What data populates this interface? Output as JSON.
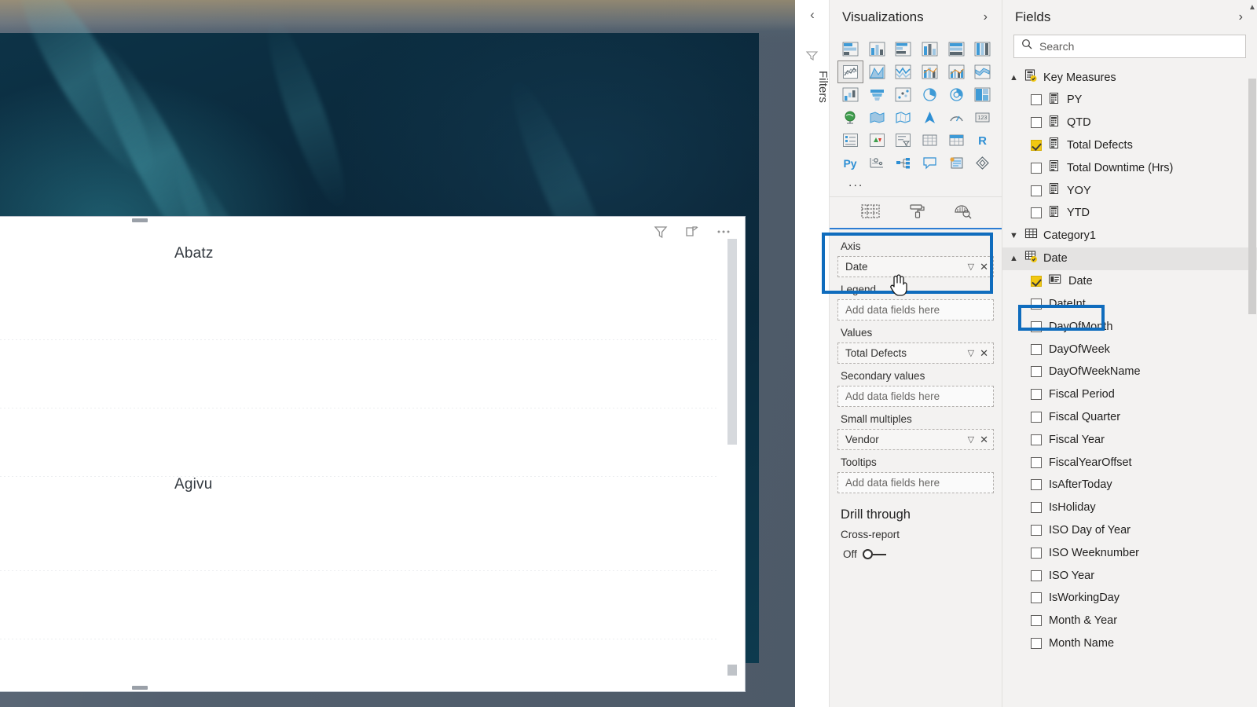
{
  "desktop": {
    "wallpaper_name": "teal-nebula-wallpaper"
  },
  "report": {
    "visual_header_icons": [
      "filter-funnel-icon",
      "focus-mode-icon",
      "more-options-icon"
    ],
    "small_multiples": [
      {
        "title": "Abatz"
      },
      {
        "title": "Agivu"
      }
    ]
  },
  "filters_rail": {
    "collapse_icon": "chevron-left-icon",
    "funnel_icon": "filter-funnel-icon",
    "label": "Filters"
  },
  "visualizations": {
    "title": "Visualizations",
    "expand_icon": "chevron-right-icon",
    "more_label": "...",
    "gallery": [
      [
        "stacked-bar-chart",
        "stacked-column-chart",
        "clustered-bar-chart",
        "clustered-column-chart",
        "100-stacked-bar-chart",
        "100-stacked-column-chart"
      ],
      [
        "line-chart",
        "area-chart",
        "stacked-area-chart",
        "line-stacked-column-chart",
        "line-clustered-column-chart",
        "ribbon-chart"
      ],
      [
        "waterfall-chart",
        "funnel-chart",
        "scatter-chart",
        "pie-chart",
        "donut-chart",
        "treemap"
      ],
      [
        "map",
        "filled-map",
        "shape-map",
        "arcgis-map",
        "gauge-chart",
        "card"
      ],
      [
        "multi-row-card",
        "kpi",
        "slicer",
        "table",
        "matrix",
        "r-script-visual"
      ],
      [
        "py-script-visual",
        "key-influencers",
        "decomposition-tree",
        "q-and-a",
        "paginated-report",
        "power-apps"
      ]
    ],
    "selected_visual": "line-chart",
    "tabs": [
      {
        "name": "fields-tab",
        "icon": "fields-grid-icon",
        "active": true
      },
      {
        "name": "format-tab",
        "icon": "paint-roller-icon",
        "active": false
      },
      {
        "name": "analytics-tab",
        "icon": "magnifier-brush-icon",
        "active": false
      }
    ],
    "wells": [
      {
        "label": "Axis",
        "value": "Date",
        "placeholder": "",
        "filled": true,
        "highlighted": true
      },
      {
        "label": "Legend",
        "value": "",
        "placeholder": "Add data fields here",
        "filled": false,
        "highlighted": false
      },
      {
        "label": "Values",
        "value": "Total Defects",
        "placeholder": "",
        "filled": true,
        "highlighted": false
      },
      {
        "label": "Secondary values",
        "value": "",
        "placeholder": "Add data fields here",
        "filled": false,
        "highlighted": false
      },
      {
        "label": "Small multiples",
        "value": "Vendor",
        "placeholder": "",
        "filled": true,
        "highlighted": false
      },
      {
        "label": "Tooltips",
        "value": "",
        "placeholder": "Add data fields here",
        "filled": false,
        "highlighted": false
      }
    ],
    "drill_through": {
      "title": "Drill through",
      "cross_report_label": "Cross-report",
      "cross_report_state": "Off"
    }
  },
  "fields": {
    "title": "Fields",
    "expand_icon": "chevron-right-icon",
    "search": {
      "placeholder": "Search",
      "value": "",
      "icon": "search-icon"
    },
    "tables": [
      {
        "name": "Key Measures",
        "icon": "measure-table-icon",
        "expanded": true,
        "selected": false,
        "fields": [
          {
            "name": "PY",
            "checked": false,
            "icon": "measure-icon"
          },
          {
            "name": "QTD",
            "checked": false,
            "icon": "measure-icon"
          },
          {
            "name": "Total Defects",
            "checked": true,
            "icon": "measure-icon"
          },
          {
            "name": "Total Downtime (Hrs)",
            "checked": false,
            "icon": "measure-icon"
          },
          {
            "name": "YOY",
            "checked": false,
            "icon": "measure-icon"
          },
          {
            "name": "YTD",
            "checked": false,
            "icon": "measure-icon"
          }
        ]
      },
      {
        "name": "Category1",
        "icon": "table-icon",
        "expanded": false,
        "selected": false,
        "fields": []
      },
      {
        "name": "Date",
        "icon": "date-table-icon",
        "expanded": true,
        "selected": true,
        "fields": [
          {
            "name": "Date",
            "checked": true,
            "icon": "date-hierarchy-icon",
            "highlighted": true
          },
          {
            "name": "DateInt",
            "checked": false,
            "icon": ""
          },
          {
            "name": "DayOfMonth",
            "checked": false,
            "icon": ""
          },
          {
            "name": "DayOfWeek",
            "checked": false,
            "icon": ""
          },
          {
            "name": "DayOfWeekName",
            "checked": false,
            "icon": ""
          },
          {
            "name": "Fiscal Period",
            "checked": false,
            "icon": ""
          },
          {
            "name": "Fiscal Quarter",
            "checked": false,
            "icon": ""
          },
          {
            "name": "Fiscal Year",
            "checked": false,
            "icon": ""
          },
          {
            "name": "FiscalYearOffset",
            "checked": false,
            "icon": ""
          },
          {
            "name": "IsAfterToday",
            "checked": false,
            "icon": ""
          },
          {
            "name": "IsHoliday",
            "checked": false,
            "icon": ""
          },
          {
            "name": "ISO Day of Year",
            "checked": false,
            "icon": ""
          },
          {
            "name": "ISO Weeknumber",
            "checked": false,
            "icon": ""
          },
          {
            "name": "ISO Year",
            "checked": false,
            "icon": ""
          },
          {
            "name": "IsWorkingDay",
            "checked": false,
            "icon": ""
          },
          {
            "name": "Month & Year",
            "checked": false,
            "icon": ""
          },
          {
            "name": "Month Name",
            "checked": false,
            "icon": ""
          }
        ]
      }
    ]
  },
  "colors": {
    "accent_blue": "#0f6cbd",
    "checkbox_yellow": "#f2c811",
    "pane_background": "#f3f2f1",
    "icon_blue": "#2e8fd4"
  }
}
